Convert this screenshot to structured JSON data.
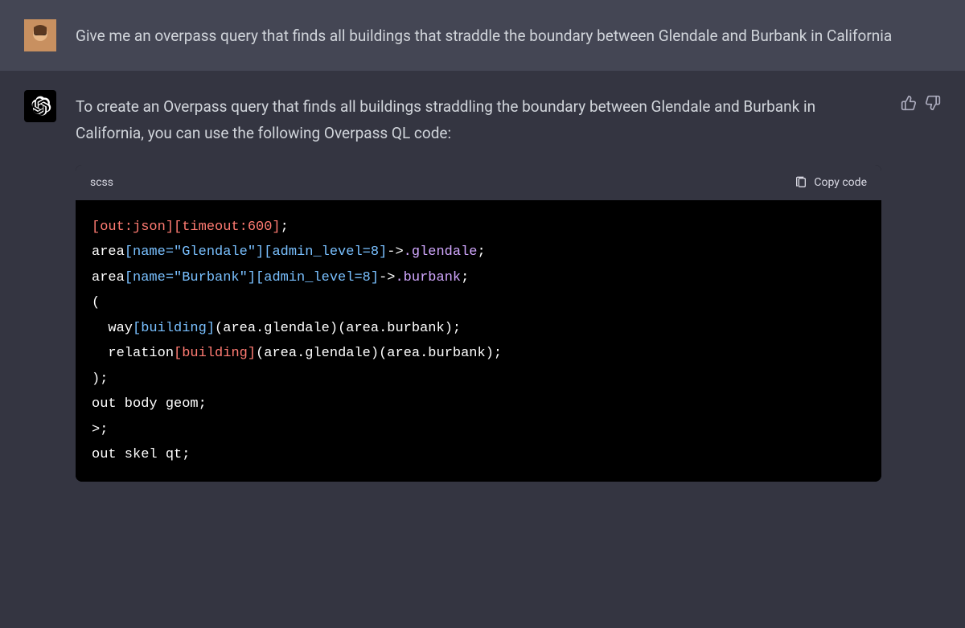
{
  "user": {
    "message": "Give me an overpass query that finds all buildings that straddle the boundary between Glendale and Burbank in California"
  },
  "assistant": {
    "intro": "To create an Overpass query that finds all buildings straddling the boundary between Glendale and Burbank in California, you can use the following Overpass QL code:"
  },
  "code": {
    "language": "scss",
    "copy_label": "Copy code",
    "l1a": "[out:json][timeout:600]",
    "l1b": ";",
    "l2a": "area",
    "l2b": "[name=\"Glendale\"][admin_level=8]",
    "l2c": "->",
    "l2d": ".glendale",
    "l2e": ";",
    "l3a": "area",
    "l3b": "[name=\"Burbank\"][admin_level=8]",
    "l3c": "->",
    "l3d": ".burbank",
    "l3e": ";",
    "l4": "(",
    "l5a": "  way",
    "l5b": "[building]",
    "l5c": "(area.glendale)(area.burbank);",
    "l6a": "  relation",
    "l6b": "[building]",
    "l6c": "(area.glendale)(area.burbank);",
    "l7": ");",
    "l8": "out body geom;",
    "l9": ">;",
    "l10": "out skel qt;"
  }
}
